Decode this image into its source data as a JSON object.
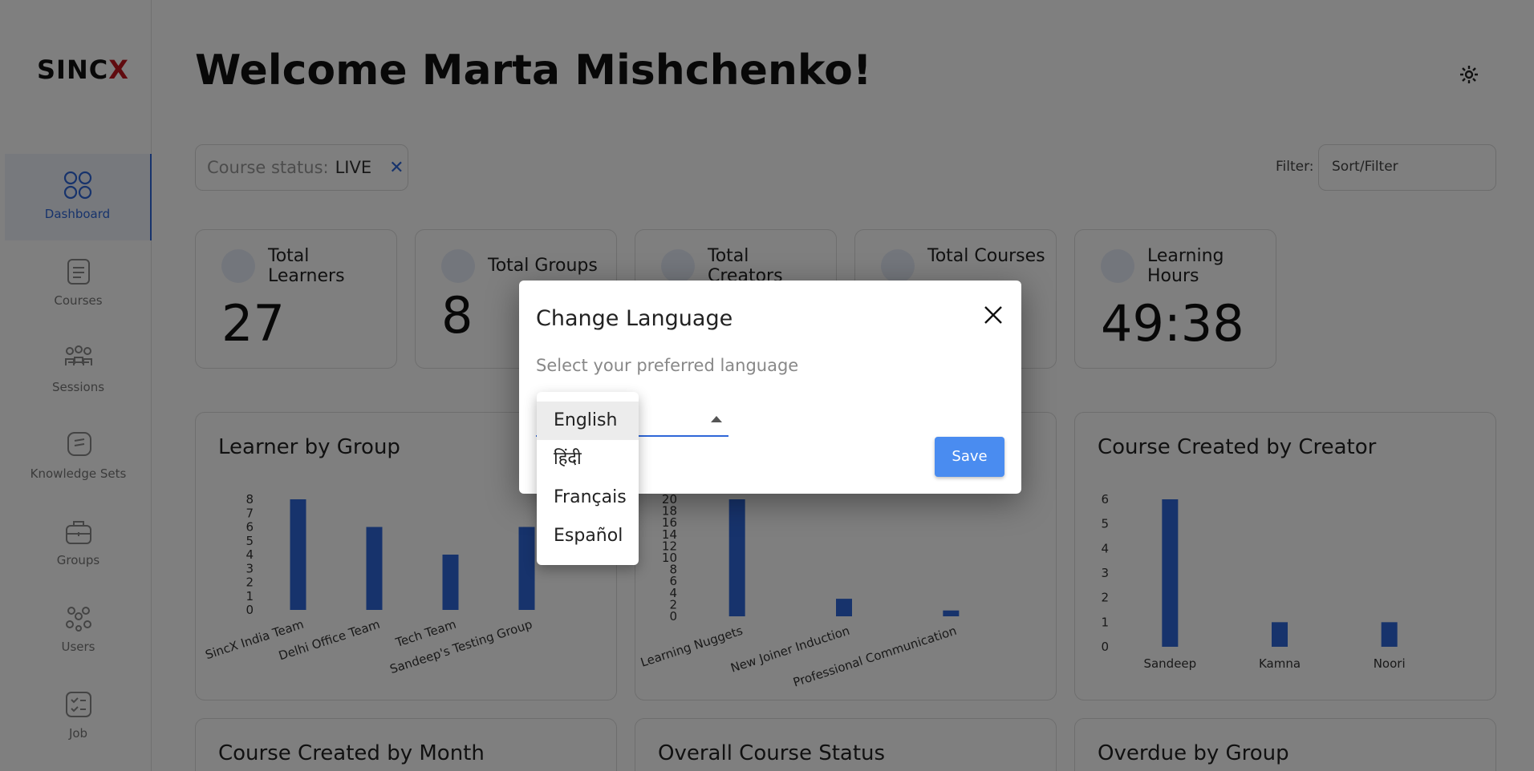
{
  "brand": {
    "logo_prefix": "SINC",
    "logo_accent": "X"
  },
  "sidebar": {
    "items": [
      {
        "label": "Dashboard",
        "icon": "dashboard-icon",
        "active": true
      },
      {
        "label": "Courses",
        "icon": "courses-icon"
      },
      {
        "label": "Sessions",
        "icon": "sessions-icon"
      },
      {
        "label": "Knowledge Sets",
        "icon": "knowledge-sets-icon"
      },
      {
        "label": "Groups",
        "icon": "groups-icon"
      },
      {
        "label": "Users",
        "icon": "users-icon"
      },
      {
        "label": "Job",
        "icon": "job-icon"
      }
    ]
  },
  "header": {
    "welcome": "Welcome Marta Mishchenko!"
  },
  "course_status_chip": {
    "key": "Course status:",
    "value": "LIVE",
    "remove": "✕"
  },
  "filter": {
    "label": "Filter:",
    "value": "Sort/Filter"
  },
  "stats": [
    {
      "title": "Total Learners",
      "value": "27"
    },
    {
      "title": "Total Groups",
      "value": "8"
    },
    {
      "title": "Total Creators",
      "value": ""
    },
    {
      "title": "Total Courses",
      "value": ""
    },
    {
      "title": "Learning Hours",
      "value": "49:38"
    }
  ],
  "cards": {
    "learner_by_group": "Learner by Group",
    "course_created_by_creator": "Course Created by Creator",
    "course_created_by_month": "Course Created by Month",
    "overall_course_status": "Overall Course Status",
    "overdue_by_group": "Overdue by Group"
  },
  "chart_data": [
    {
      "type": "bar",
      "title": "Learner by Group",
      "categories": [
        "SincX India Team",
        "Delhi Office Team",
        "Tech Team",
        "Sandeep's Testing Group"
      ],
      "values": [
        8,
        6,
        4,
        6
      ],
      "yticks": [
        "0",
        "1",
        "2",
        "3",
        "4",
        "5",
        "6",
        "7",
        "8"
      ],
      "ylim": [
        0,
        8
      ],
      "color": "#2f67d8"
    },
    {
      "type": "bar",
      "title": "",
      "categories": [
        "Learning Nuggets",
        "New Joiner Induction",
        "Professional Communication"
      ],
      "values": [
        20,
        3,
        1
      ],
      "yticks": [
        "0",
        "2",
        "4",
        "6",
        "8",
        "10",
        "12",
        "14",
        "16",
        "18",
        "20"
      ],
      "ylim": [
        0,
        20
      ],
      "color": "#2f67d8"
    },
    {
      "type": "bar",
      "title": "Course Created by Creator",
      "categories": [
        "Sandeep",
        "Kamna",
        "Noori"
      ],
      "values": [
        6,
        1,
        1
      ],
      "yticks": [
        "0",
        "1",
        "2",
        "3",
        "4",
        "5",
        "6"
      ],
      "ylim": [
        0,
        6
      ],
      "color": "#2f67d8"
    }
  ],
  "modal": {
    "title": "Change Language",
    "subtitle": "Select your preferred language",
    "save": "Save",
    "options": [
      "English",
      "हिंदी",
      "Français",
      "Español"
    ],
    "selected": "English"
  }
}
